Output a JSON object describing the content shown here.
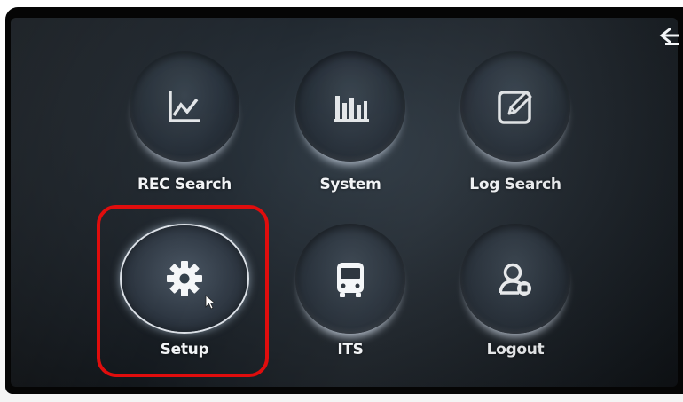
{
  "menu": {
    "items": [
      {
        "id": "rec_search",
        "label": "REC Search",
        "icon": "line-chart-icon"
      },
      {
        "id": "system",
        "label": "System",
        "icon": "bar-chart-icon"
      },
      {
        "id": "log_search",
        "label": "Log Search",
        "icon": "edit-icon"
      },
      {
        "id": "setup",
        "label": "Setup",
        "icon": "gear-icon",
        "selected": true
      },
      {
        "id": "its",
        "label": "ITS",
        "icon": "bus-icon"
      },
      {
        "id": "logout",
        "label": "Logout",
        "icon": "user-logout-icon"
      }
    ]
  },
  "nav": {
    "back_icon": "back-arrow-icon"
  },
  "annotation": {
    "color": "#e00d0d",
    "target": "setup"
  }
}
